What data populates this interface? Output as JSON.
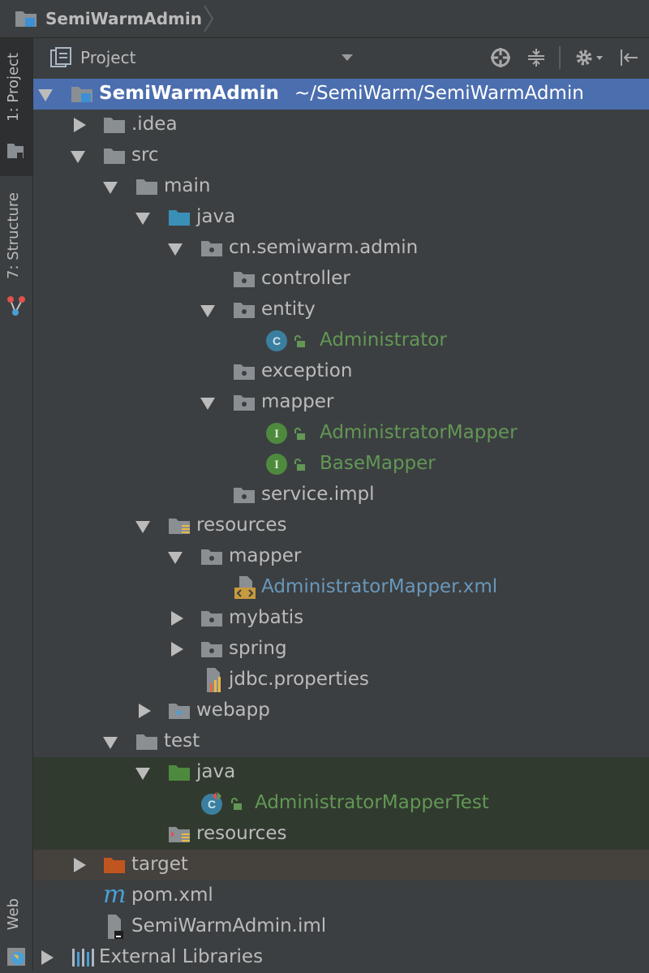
{
  "breadcrumb": {
    "project": "SemiWarmAdmin"
  },
  "toolstrip": {
    "project_tab": "1: Project",
    "structure_tab": "7: Structure",
    "web_tab": "Web"
  },
  "panel": {
    "title": "Project"
  },
  "tree": {
    "root_name": "SemiWarmAdmin",
    "root_path": "~/SemiWarm/SemiWarmAdmin",
    "idea": ".idea",
    "src": "src",
    "main": "main",
    "java": "java",
    "package": "cn.semiwarm.admin",
    "controller": "controller",
    "entity": "entity",
    "administrator": "Administrator",
    "exception": "exception",
    "mapper": "mapper",
    "administrator_mapper": "AdministratorMapper",
    "base_mapper": "BaseMapper",
    "service_impl": "service.impl",
    "resources": "resources",
    "res_mapper": "mapper",
    "administrator_mapper_xml": "AdministratorMapper.xml",
    "mybatis": "mybatis",
    "spring": "spring",
    "jdbc_properties": "jdbc.properties",
    "webapp": "webapp",
    "test": "test",
    "test_java": "java",
    "administrator_mapper_test": "AdministratorMapperTest",
    "test_resources": "resources",
    "target": "target",
    "pom": "pom.xml",
    "iml": "SemiWarmAdmin.iml",
    "external_libraries": "External Libraries"
  },
  "colors": {
    "selection": "#4b6eaf",
    "green_text": "#629755",
    "blue_text": "#6897bb",
    "folder": "#8a8f93"
  }
}
